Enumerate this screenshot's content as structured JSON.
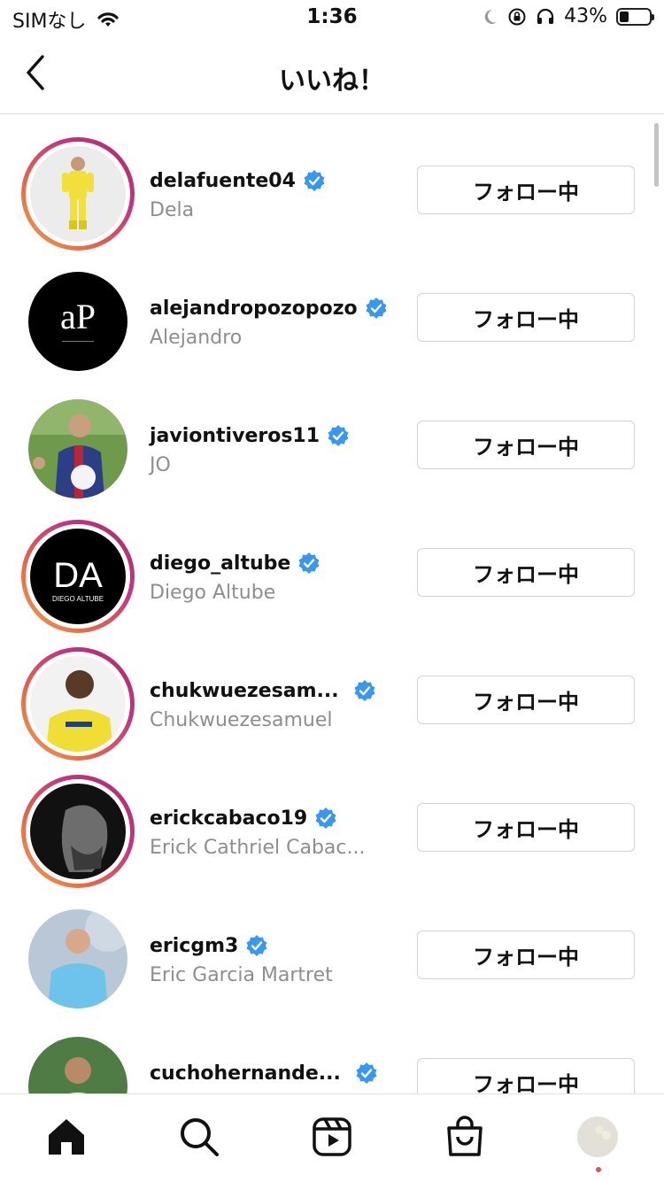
{
  "status_bar": {
    "carrier": "SIMなし",
    "time": "1:36",
    "battery_pct": "43%"
  },
  "header": {
    "title": "いいね！"
  },
  "follow_label": "フォロー中",
  "users": [
    {
      "username": "delafuente04",
      "full_name": "Dela",
      "verified": true,
      "story_ring": true,
      "avatar_bg": "#e9e9e9",
      "avatar_fg": "#f2e03a"
    },
    {
      "username": "alejandropozopozo",
      "full_name": "Alejandro",
      "verified": true,
      "story_ring": false,
      "avatar_bg": "#000000",
      "avatar_fg": "#ffffff",
      "avatar_text": "aP"
    },
    {
      "username": "javiontiveros11",
      "full_name": "JO",
      "verified": true,
      "story_ring": false,
      "avatar_bg": "#6f9a4c",
      "avatar_fg": "#2d3e86"
    },
    {
      "username": "diego_altube",
      "full_name": "Diego Altube",
      "verified": true,
      "story_ring": true,
      "avatar_bg": "#000000",
      "avatar_fg": "#ffffff",
      "avatar_text": "DA",
      "avatar_sub": "DIEGO ALTUBE"
    },
    {
      "username": "chukwuezesam...",
      "full_name": "Chukwuezesamuel",
      "verified": true,
      "story_ring": true,
      "avatar_bg": "#f2f2f2",
      "avatar_fg": "#f1de34"
    },
    {
      "username": "erickcabaco19",
      "full_name": "Erick Cathriel Cabac...",
      "verified": true,
      "story_ring": true,
      "avatar_bg": "#111111",
      "avatar_fg": "#6d6d6d"
    },
    {
      "username": "ericgm3",
      "full_name": "Eric Garcia Martret",
      "verified": true,
      "story_ring": false,
      "avatar_bg": "#b9c7d6",
      "avatar_fg": "#6ec3ec"
    },
    {
      "username": "cuchohernande...",
      "full_name": "",
      "verified": true,
      "story_ring": false,
      "avatar_bg": "#4f7b45",
      "avatar_fg": "#ffffff"
    }
  ],
  "tabbar": {
    "items": [
      "home-icon",
      "search-icon",
      "reels-icon",
      "shop-icon",
      "profile-avatar"
    ]
  },
  "colors": {
    "verified": "#3897f0",
    "notification_dot": "#ed4956"
  }
}
